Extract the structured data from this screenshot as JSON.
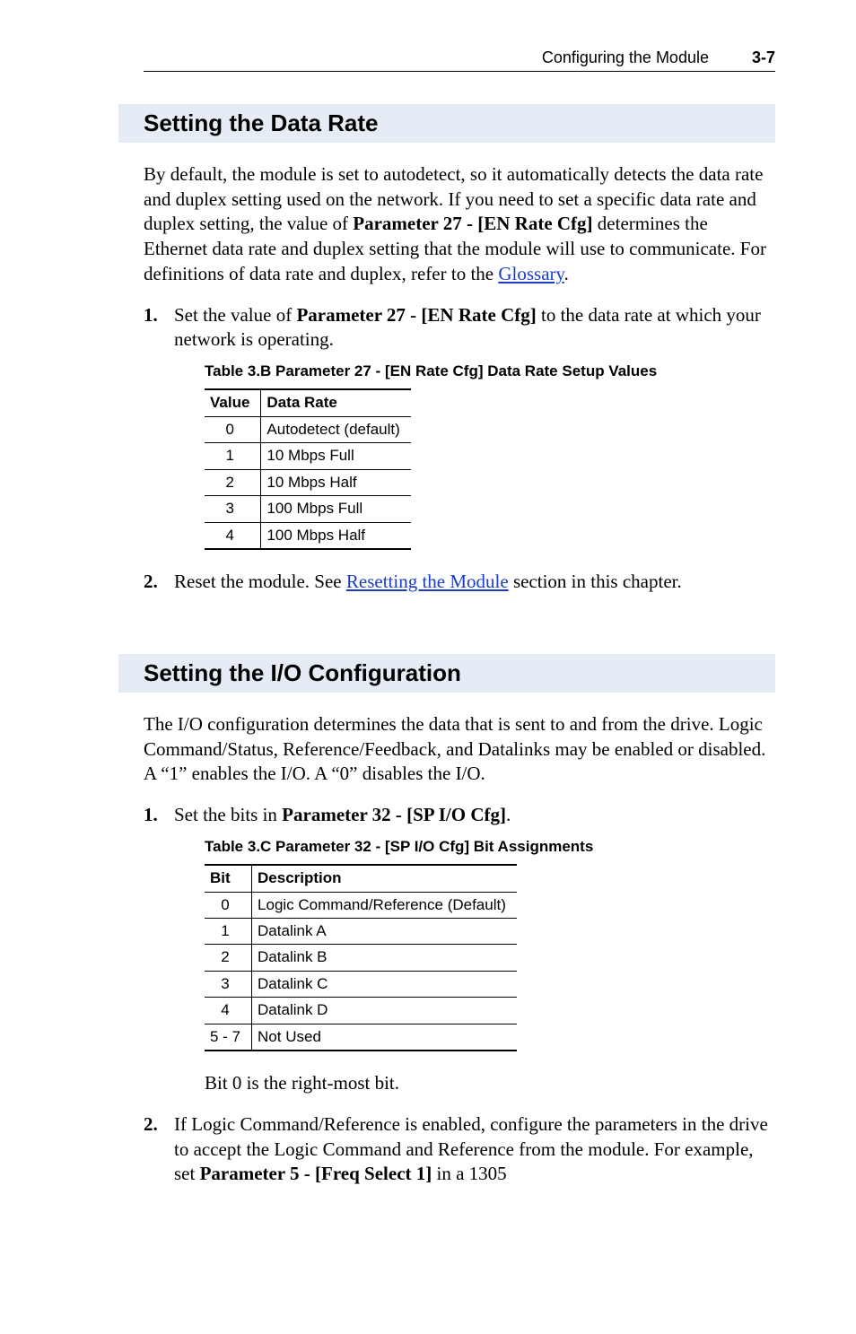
{
  "running_head": {
    "title": "Configuring the Module",
    "page": "3-7"
  },
  "section1": {
    "heading": "Setting the Data Rate",
    "intro_parts": {
      "p1": "By default, the module is set to autodetect, so it automatically detects the data rate and duplex setting used on the network. If you need to set a specific data rate and duplex setting, the value of ",
      "bold1": "Parameter 27 - [EN Rate Cfg]",
      "p2": " determines the Ethernet data rate and duplex setting that the module will use to communicate. For definitions of data rate and duplex, refer to the ",
      "link": "Glossary",
      "p3": "."
    },
    "step1": {
      "num": "1.",
      "pre": "Set the value of ",
      "bold": "Parameter 27 - [EN Rate Cfg]",
      "post": " to the data rate at which your network is operating."
    },
    "table_caption": "Table 3.B   Parameter 27 - [EN Rate Cfg] Data Rate Setup Values",
    "table_headers": {
      "c1": "Value",
      "c2": "Data Rate"
    },
    "table_rows": [
      {
        "v": "0",
        "d": "Autodetect (default)"
      },
      {
        "v": "1",
        "d": "10 Mbps Full"
      },
      {
        "v": "2",
        "d": "10 Mbps Half"
      },
      {
        "v": "3",
        "d": "100 Mbps Full"
      },
      {
        "v": "4",
        "d": "100 Mbps Half"
      }
    ],
    "step2": {
      "num": "2.",
      "pre": "Reset the module. See ",
      "link": "Resetting the Module",
      "post": " section in this chapter."
    }
  },
  "section2": {
    "heading": "Setting the I/O Configuration",
    "intro": "The I/O configuration determines the data that is sent to and from the drive. Logic Command/Status, Reference/Feedback, and Datalinks may be enabled or disabled. A “1” enables the I/O. A “0” disables the I/O.",
    "step1": {
      "num": "1.",
      "pre": "Set the bits in ",
      "bold": "Parameter 32 - [SP I/O Cfg]",
      "post": "."
    },
    "table_caption": "Table 3.C   Parameter 32 - [SP I/O Cfg] Bit Assignments",
    "table_headers": {
      "c1": "Bit",
      "c2": "Description"
    },
    "table_rows": [
      {
        "b": "0",
        "d": "Logic Command/Reference (Default)"
      },
      {
        "b": "1",
        "d": "Datalink A"
      },
      {
        "b": "2",
        "d": "Datalink B"
      },
      {
        "b": "3",
        "d": "Datalink C"
      },
      {
        "b": "4",
        "d": "Datalink D"
      },
      {
        "b": "5 - 7",
        "d": "Not Used"
      }
    ],
    "note": "Bit 0 is the right-most bit.",
    "step2": {
      "num": "2.",
      "pre": "If Logic Command/Reference is enabled, configure the parameters in the drive to accept the Logic Command and Reference from the module. For example, set ",
      "bold": "Parameter 5 - [Freq Select 1]",
      "post": " in a 1305"
    }
  }
}
